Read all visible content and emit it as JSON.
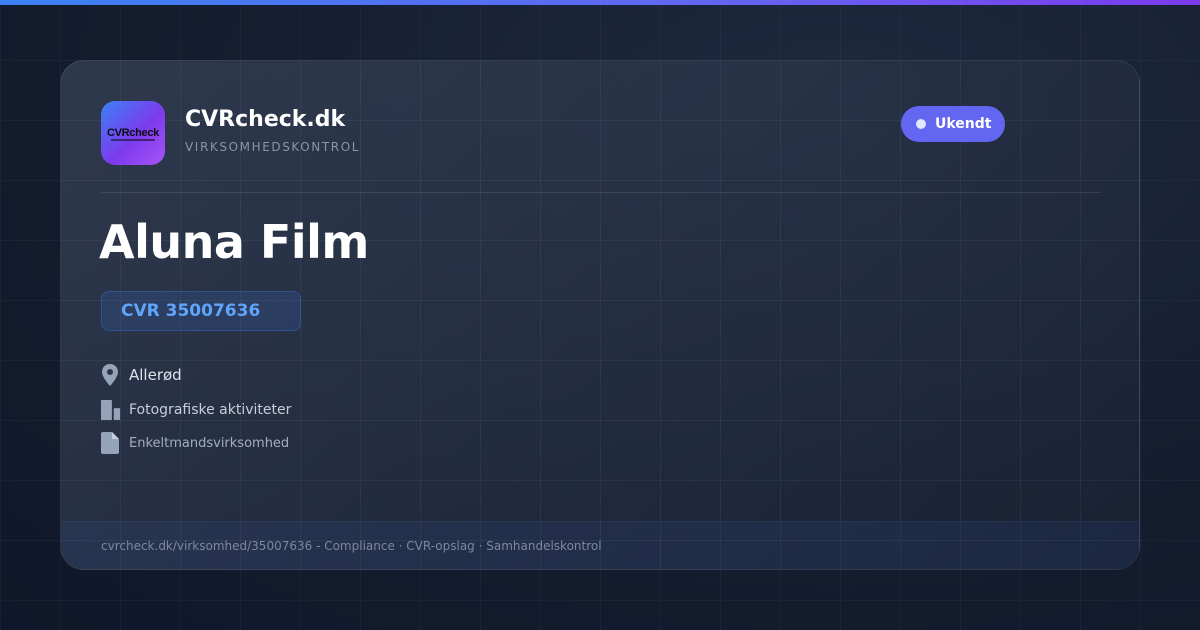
{
  "brand": {
    "name": "CVRcheck.dk",
    "subtitle": "VIRKSOMHEDSKONTROL",
    "logo_text": "CVRcheck"
  },
  "status": {
    "label": "Ukendt",
    "color": "#6366f1"
  },
  "company": {
    "name": "Aluna Film",
    "cvr": "CVR 35007636",
    "city": "Allerød",
    "industry": "Fotografiske aktiviteter",
    "type": "Enkeltmandsvirksomhed"
  },
  "icons": {
    "city": "map-pin-icon",
    "industry": "building-icon",
    "type": "document-icon"
  },
  "footer": {
    "text": "cvrcheck.dk/virksomhed/35007636 - Compliance · CVR-opslag · Samhandelskontrol"
  },
  "colors": {
    "accent": "#3b82f6",
    "accent_purple": "#7c3aed",
    "cvr_text": "#60a5fa",
    "background": "#141c2e"
  }
}
